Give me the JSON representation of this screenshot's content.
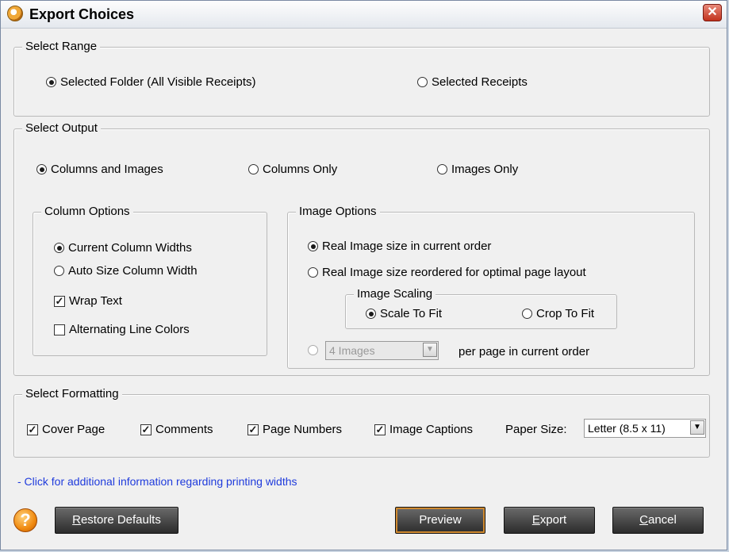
{
  "window": {
    "title": "Export Choices"
  },
  "select_range": {
    "legend": "Select Range",
    "options": [
      {
        "label": "Selected Folder (All Visible Receipts)",
        "selected": true
      },
      {
        "label": "Selected Receipts",
        "selected": false
      }
    ]
  },
  "select_output": {
    "legend": "Select Output",
    "options": [
      {
        "label": "Columns and Images",
        "selected": true
      },
      {
        "label": "Columns Only",
        "selected": false
      },
      {
        "label": "Images Only",
        "selected": false
      }
    ],
    "column_options": {
      "legend": "Column Options",
      "current_widths": "Current Column Widths",
      "auto_size": "Auto Size Column Width",
      "wrap_text": "Wrap Text",
      "alternating": "Alternating Line Colors"
    },
    "image_options": {
      "legend": "Image Options",
      "real_size": "Real Image size in current order",
      "reordered": "Real Image size reordered for optimal page layout",
      "scaling": {
        "legend": "Image Scaling",
        "scale_to_fit": "Scale To Fit",
        "crop_to_fit": "Crop To Fit"
      },
      "images_per_page_value": "4 Images",
      "per_page_label": "per page in current order"
    }
  },
  "select_formatting": {
    "legend": "Select Formatting",
    "cover_page": "Cover Page",
    "comments": "Comments",
    "page_numbers": "Page Numbers",
    "image_captions": "Image Captions",
    "paper_size_label": "Paper Size:",
    "paper_size_value": "Letter (8.5 x 11)"
  },
  "info_link": "- Click for additional information regarding printing widths",
  "buttons": {
    "help": "?",
    "restore_defaults_underlined": "R",
    "restore_defaults_rest": "estore Defaults",
    "preview": "Preview",
    "export_underlined": "E",
    "export_rest": "xport",
    "cancel_underlined": "C",
    "cancel_rest": "ancel"
  },
  "icons": [
    "app-icon",
    "close-icon",
    "help-icon",
    "chevron-down-icon"
  ]
}
